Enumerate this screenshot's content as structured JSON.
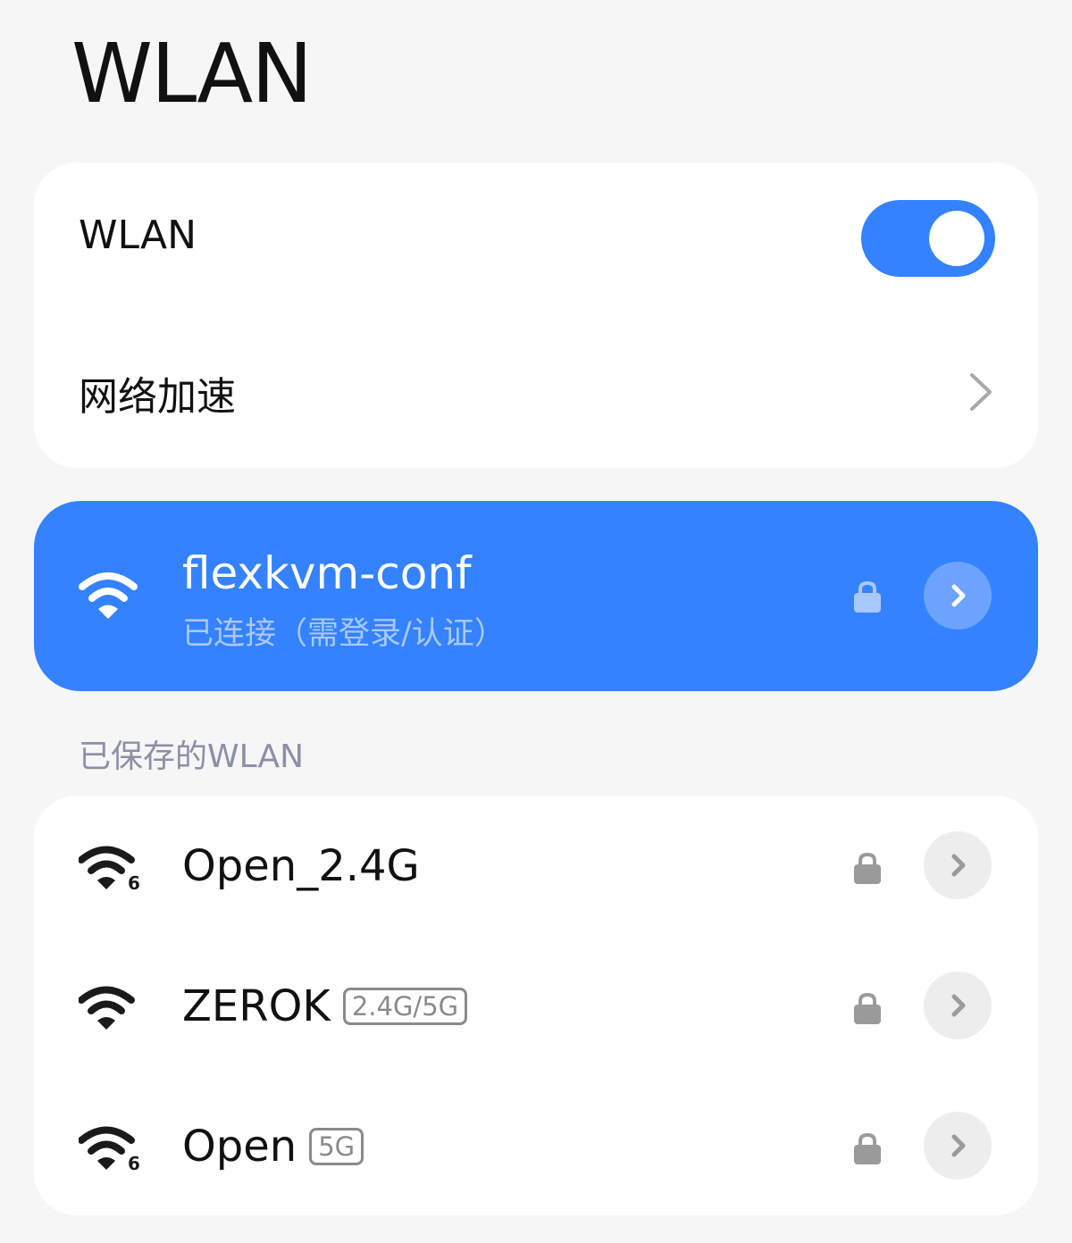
{
  "page": {
    "title": "WLAN"
  },
  "settings": {
    "wlan_toggle": {
      "label": "WLAN",
      "state": "on"
    },
    "acceleration": {
      "label": "网络加速"
    }
  },
  "connected": {
    "ssid": "flexkvm-conf",
    "status": "已连接（需登录/认证）",
    "secured": true,
    "icon": "wifi-icon"
  },
  "saved": {
    "header": "已保存的WLAN",
    "networks": [
      {
        "ssid": "Open_2.4G",
        "badge": "",
        "secured": true,
        "icon": "wifi6-icon"
      },
      {
        "ssid": "ZEROK",
        "badge": "2.4G/5G",
        "secured": true,
        "icon": "wifi-icon"
      },
      {
        "ssid": "Open",
        "badge": "5G",
        "secured": true,
        "icon": "wifi6-icon"
      }
    ]
  },
  "colors": {
    "accent": "#3482ff",
    "background": "#f6f6f6",
    "card": "#ffffff",
    "section_header": "#8c8fa6"
  }
}
